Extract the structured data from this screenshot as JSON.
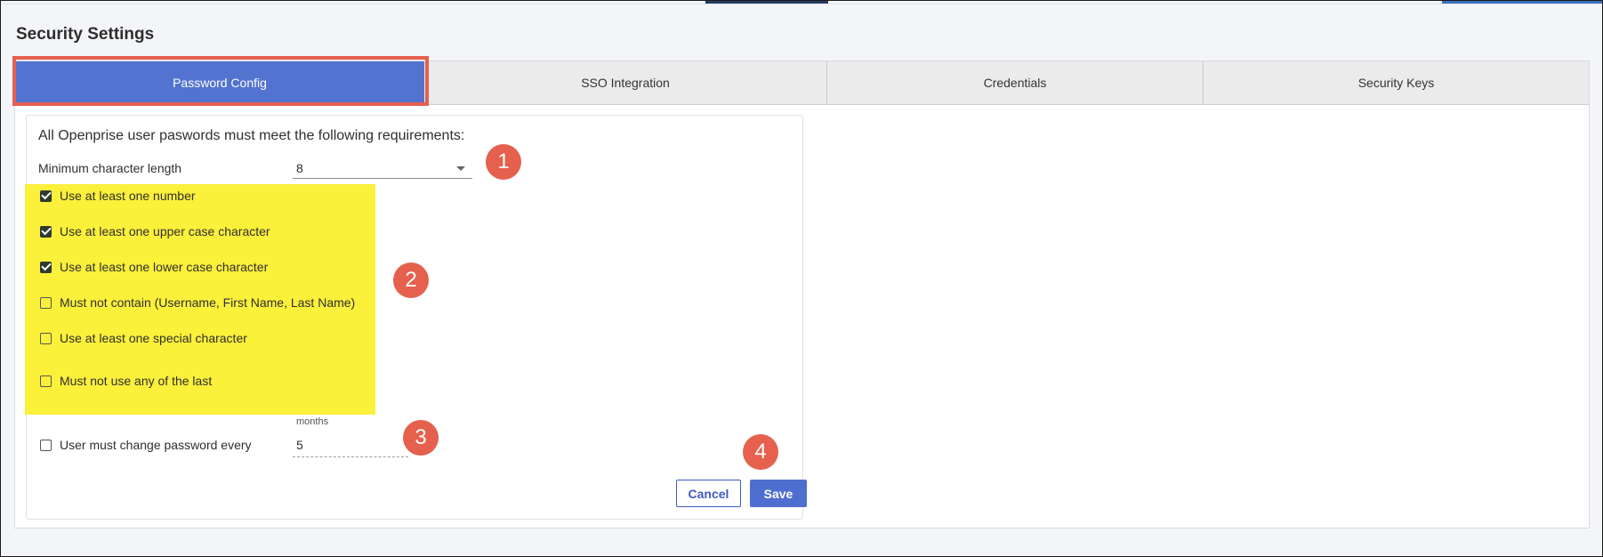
{
  "page": {
    "title": "Security Settings"
  },
  "tabs": [
    {
      "label": "Password Config",
      "active": true
    },
    {
      "label": "SSO Integration",
      "active": false
    },
    {
      "label": "Credentials",
      "active": false
    },
    {
      "label": "Security Keys",
      "active": false
    }
  ],
  "password_config": {
    "heading": "All Openprise user paswords must meet the following requirements:",
    "min_length": {
      "label": "Minimum character length",
      "value": "8"
    },
    "rules": [
      {
        "label": "Use at least one number",
        "checked": true
      },
      {
        "label": "Use at least one upper case character",
        "checked": true
      },
      {
        "label": "Use at least one lower case character",
        "checked": true
      },
      {
        "label": "Must not contain (Username, First Name, Last Name)",
        "checked": false
      },
      {
        "label": "Use at least one special character",
        "checked": false
      },
      {
        "label": "Must not use any of the last",
        "checked": false
      }
    ],
    "change_password": {
      "label": "User must change password every",
      "checked": false,
      "unit_label": "months",
      "value": "5"
    },
    "cancel_label": "Cancel",
    "save_label": "Save"
  },
  "markers": [
    "1",
    "2",
    "3",
    "4"
  ],
  "colors": {
    "accent": "#5373d0",
    "highlight_border": "#e5604d",
    "marker": "#e5604d",
    "yellow_highlight": "#fbf03a"
  }
}
